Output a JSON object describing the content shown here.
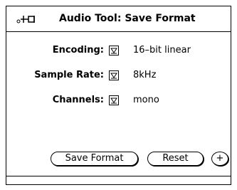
{
  "window": {
    "title": "Audio Tool: Save Format",
    "pin_icon": "pushpin-icon"
  },
  "fields": [
    {
      "label": "Encoding:",
      "value": "16–bit linear"
    },
    {
      "label": "Sample Rate:",
      "value": "8kHz"
    },
    {
      "label": "Channels:",
      "value": "mono"
    }
  ],
  "menu_icon": "menu-triangle-down-icon",
  "buttons": {
    "save_label": "Save Format",
    "reset_label": "Reset",
    "more_label": "+"
  }
}
